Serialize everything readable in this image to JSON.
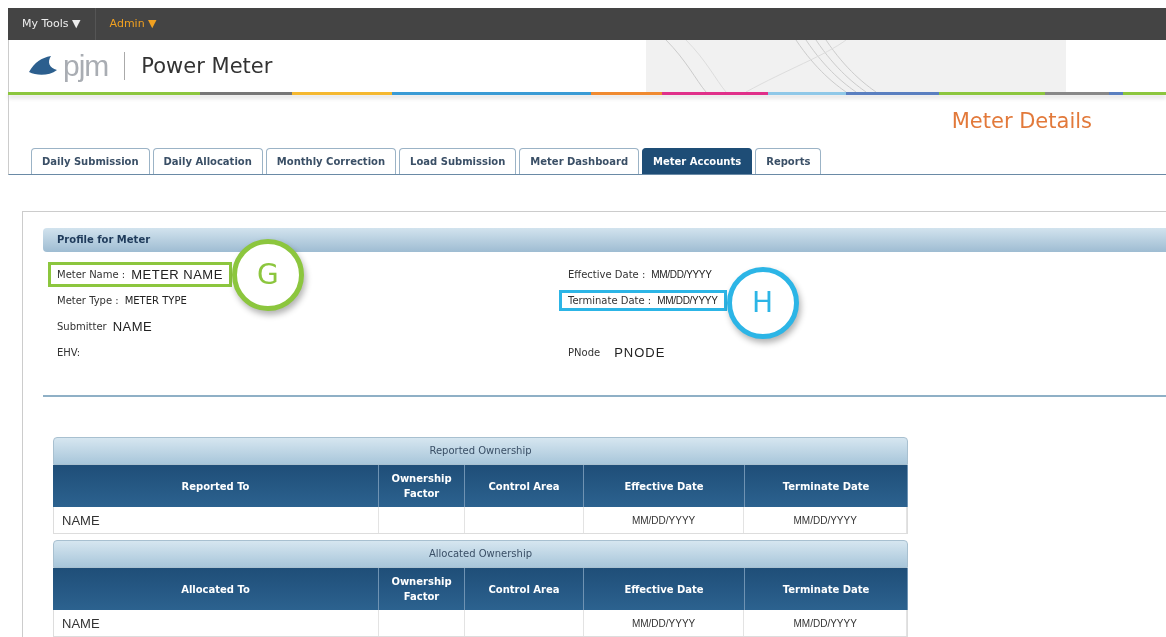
{
  "top_menu": [
    {
      "label": "My Tools ▼",
      "highlighted": false
    },
    {
      "label": "Admin ▼",
      "highlighted": true
    }
  ],
  "header": {
    "logo_text": "pjm",
    "app_title": "Power Meter"
  },
  "page_title": "Meter Details",
  "tabs": [
    {
      "label": "Daily Submission",
      "selected": false
    },
    {
      "label": "Daily Allocation",
      "selected": false
    },
    {
      "label": "Monthly Correction",
      "selected": false
    },
    {
      "label": "Load Submission",
      "selected": false
    },
    {
      "label": "Meter Dashboard",
      "selected": false
    },
    {
      "label": "Meter Accounts",
      "selected": true
    },
    {
      "label": "Reports",
      "selected": false
    }
  ],
  "profile": {
    "title": "Profile for Meter",
    "left_fields": [
      {
        "label": "Meter Name :",
        "value": "METER NAME",
        "callout": {
          "letter": "G",
          "color": "#8cc63e"
        }
      },
      {
        "label": "Meter Type :",
        "value": "METER TYPE",
        "kind": "small"
      },
      {
        "label": "Submitter",
        "value": "NAME"
      },
      {
        "label": "EHV:"
      }
    ],
    "right_fields": [
      {
        "label": "Effective Date :",
        "value": "MM/DD/YYYY",
        "kind": "date"
      },
      {
        "label": "Terminate Date :",
        "value": "MM/DD/YYYY",
        "kind": "date",
        "callout": {
          "letter": "H",
          "color": "#2cb5e6"
        }
      },
      {
        "label": "PNode",
        "value": "PNODE",
        "kind": "wide"
      }
    ]
  },
  "tables": [
    {
      "caption": "Reported Ownership",
      "columns": [
        "Reported To",
        "Ownership Factor",
        "Control Area",
        "Effective Date",
        "Terminate Date"
      ],
      "rows": [
        [
          "NAME",
          null,
          null,
          "MM/DD/YYYY",
          "MM/DD/YYYY"
        ]
      ]
    },
    {
      "caption": "Allocated Ownership",
      "columns": [
        "Allocated To",
        "Ownership Factor",
        "Control Area",
        "Effective Date",
        "Terminate Date"
      ],
      "rows": [
        [
          "NAME",
          null,
          null,
          "MM/DD/YYYY",
          "MM/DD/YYYY"
        ]
      ]
    }
  ]
}
